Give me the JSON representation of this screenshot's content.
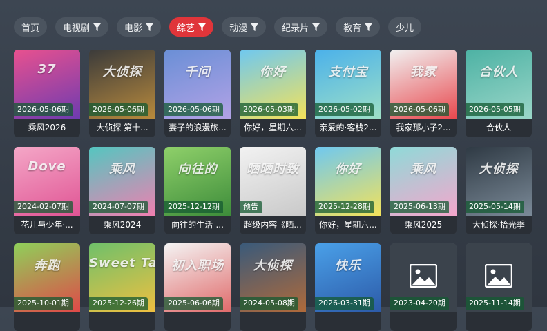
{
  "tabs": [
    {
      "label": "首页",
      "filter": false,
      "active": false
    },
    {
      "label": "电视剧",
      "filter": true,
      "active": false
    },
    {
      "label": "电影",
      "filter": true,
      "active": false
    },
    {
      "label": "综艺",
      "filter": true,
      "active": true
    },
    {
      "label": "动漫",
      "filter": true,
      "active": false
    },
    {
      "label": "纪录片",
      "filter": true,
      "active": false
    },
    {
      "label": "教育",
      "filter": true,
      "active": false
    },
    {
      "label": "少儿",
      "filter": false,
      "active": false
    }
  ],
  "cards": [
    {
      "date": "2026-05-06期",
      "title": "乘风2026",
      "thumb_text": "37",
      "colors": [
        "#e8518f",
        "#6e3bb0"
      ]
    },
    {
      "date": "2026-05-06期",
      "title": "大侦探 第十...",
      "thumb_text": "大侦探",
      "colors": [
        "#3b3b3b",
        "#b88a3c"
      ]
    },
    {
      "date": "2026-05-06期",
      "title": "妻子的浪漫旅...",
      "thumb_text": "千问",
      "colors": [
        "#6a8fd6",
        "#b2a2e6"
      ]
    },
    {
      "date": "2026-05-03期",
      "title": "你好，星期六...",
      "thumb_text": "你好",
      "colors": [
        "#6fc8f0",
        "#f3e25a"
      ]
    },
    {
      "date": "2026-05-02期",
      "title": "亲爱的·客栈2...",
      "thumb_text": "支付宝",
      "colors": [
        "#4bb1ea",
        "#9ee0c6"
      ]
    },
    {
      "date": "2026-05-06期",
      "title": "我家那小子2...",
      "thumb_text": "我家",
      "colors": [
        "#f1f1f1",
        "#e8484e"
      ]
    },
    {
      "date": "2026-05-05期",
      "title": "合伙人",
      "thumb_text": "合伙人",
      "colors": [
        "#4db2a4",
        "#9ad6c8"
      ]
    },
    {
      "date": "2024-02-07期",
      "title": "花儿与少年·...",
      "thumb_text": "Dove",
      "colors": [
        "#f4a7c7",
        "#e05494"
      ]
    },
    {
      "date": "2024-07-07期",
      "title": "乘风2024",
      "thumb_text": "乘风",
      "colors": [
        "#54c6c0",
        "#f07fb0"
      ]
    },
    {
      "date": "2025-12-12期",
      "title": "向往的生活-...",
      "thumb_text": "向往的",
      "colors": [
        "#8fd06a",
        "#3d8c3a"
      ]
    },
    {
      "date": "预告",
      "title": "超级内容《晒...",
      "thumb_text": "晒晒时致",
      "colors": [
        "#f2f2f2",
        "#c9c9c9"
      ]
    },
    {
      "date": "2025-12-28期",
      "title": "你好，星期六...",
      "thumb_text": "你好",
      "colors": [
        "#6fc8f0",
        "#f3e25a"
      ]
    },
    {
      "date": "2025-06-13期",
      "title": "乘风2025",
      "thumb_text": "乘风",
      "colors": [
        "#8fdad8",
        "#f4a6cc"
      ]
    },
    {
      "date": "2025-05-14期",
      "title": "大侦探·拾光季",
      "thumb_text": "大侦探",
      "colors": [
        "#2f3a44",
        "#7b8a98"
      ]
    },
    {
      "date": "2025-10-01期",
      "title": "",
      "thumb_text": "奔跑",
      "colors": [
        "#8fd05a",
        "#e04848"
      ]
    },
    {
      "date": "2025-12-26期",
      "title": "",
      "thumb_text": "Sweet Task",
      "colors": [
        "#6fc06a",
        "#f0c040"
      ]
    },
    {
      "date": "2025-06-06期",
      "title": "",
      "thumb_text": "初入职场",
      "colors": [
        "#f4f4f4",
        "#e06a6a"
      ]
    },
    {
      "date": "2024-05-08期",
      "title": "",
      "thumb_text": "大侦探",
      "colors": [
        "#3a5a7a",
        "#b06a3a"
      ]
    },
    {
      "date": "2026-03-31期",
      "title": "",
      "thumb_text": "快乐",
      "colors": [
        "#4aa0e8",
        "#2c5aa8"
      ]
    },
    {
      "date": "2023-04-20期",
      "title": "",
      "thumb_text": "",
      "colors": [
        "#3b434c",
        "#3b434c"
      ],
      "placeholder": true
    },
    {
      "date": "2025-11-14期",
      "title": "",
      "thumb_text": "",
      "colors": [
        "#3b434c",
        "#3b434c"
      ],
      "placeholder": true
    }
  ]
}
